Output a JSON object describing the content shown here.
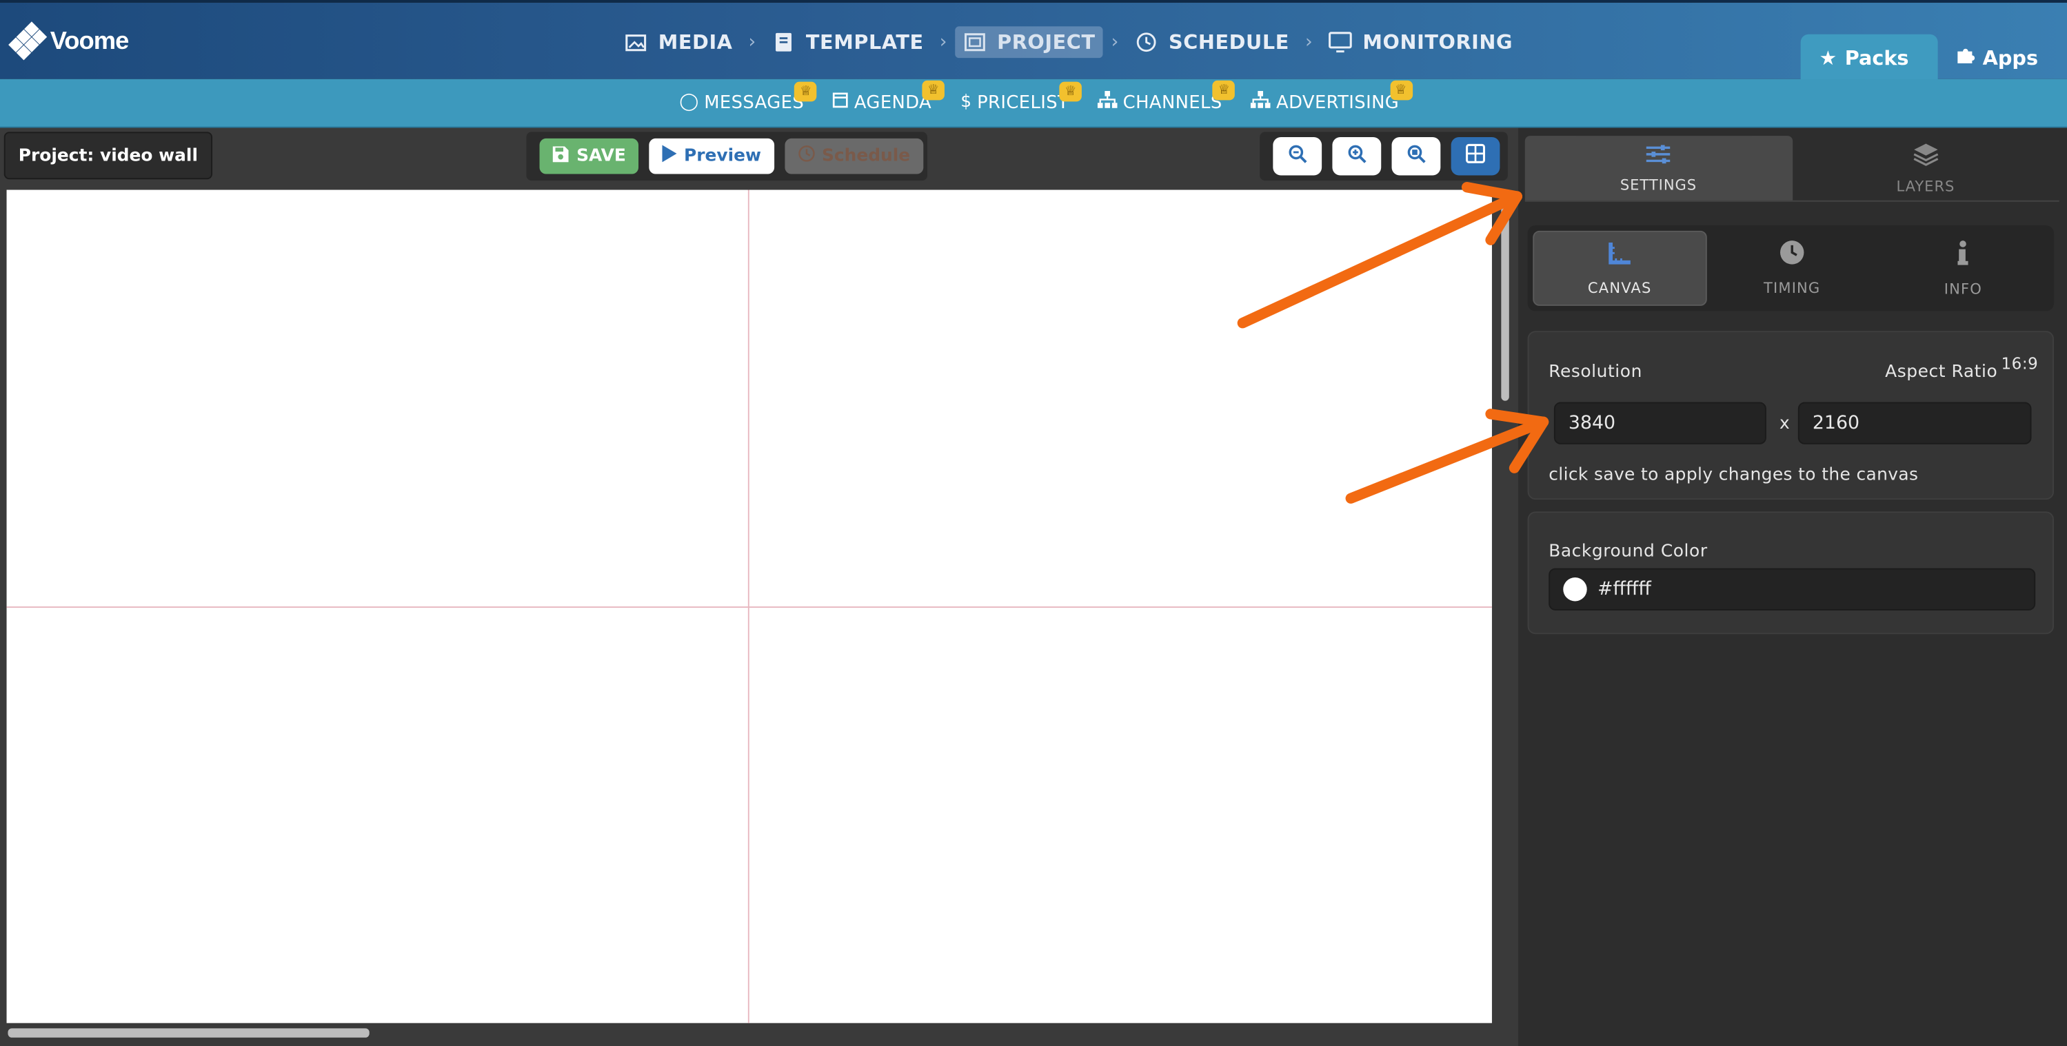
{
  "app": {
    "logo_text": "Voome"
  },
  "main_nav": [
    {
      "label": "MEDIA",
      "icon": "image-icon"
    },
    {
      "label": "TEMPLATE",
      "icon": "book-icon"
    },
    {
      "label": "PROJECT",
      "icon": "project-icon",
      "active": true
    },
    {
      "label": "SCHEDULE",
      "icon": "clock-icon"
    },
    {
      "label": "MONITORING",
      "icon": "monitor-icon"
    }
  ],
  "pack_tabs": [
    {
      "label": "Packs",
      "icon": "star-icon",
      "active": true
    },
    {
      "label": "Apps",
      "icon": "puzzle-icon"
    }
  ],
  "sub_nav": [
    {
      "label": "MESSAGES",
      "icon": "chat-icon",
      "premium": true
    },
    {
      "label": "AGENDA",
      "icon": "calendar-icon",
      "premium": true
    },
    {
      "label": "PRICELIST",
      "icon": "dollar-icon",
      "premium": true
    },
    {
      "label": "CHANNELS",
      "icon": "sitemap-icon",
      "premium": true
    },
    {
      "label": "ADVERTISING",
      "icon": "sitemap-icon",
      "premium": true
    }
  ],
  "toolbar": {
    "project_title": "Project: video wall",
    "save_label": "SAVE",
    "preview_label": "Preview",
    "schedule_label": "Schedule"
  },
  "right_panel": {
    "tabs": [
      {
        "label": "SETTINGS",
        "icon": "sliders-icon",
        "active": true
      },
      {
        "label": "LAYERS",
        "icon": "layers-icon"
      }
    ],
    "sub_tabs": [
      {
        "label": "CANVAS",
        "icon": "ruler-icon",
        "active": true
      },
      {
        "label": "TIMING",
        "icon": "clock-icon"
      },
      {
        "label": "INFO",
        "icon": "info-icon"
      }
    ],
    "resolution": {
      "label": "Resolution",
      "aspect_label": "Aspect Ratio",
      "aspect_value": "16:9",
      "width": "3840",
      "separator": "x",
      "height": "2160",
      "hint": "click save to apply changes to the canvas"
    },
    "background": {
      "label": "Background Color",
      "value": "#ffffff"
    }
  },
  "colors": {
    "topbar": "#2b5d92",
    "subbar": "#3d99bd",
    "accent": "#2e6fb4",
    "save_green": "#69b36f",
    "annotation_arrow": "#f26a12",
    "crown": "#f2c12e"
  }
}
